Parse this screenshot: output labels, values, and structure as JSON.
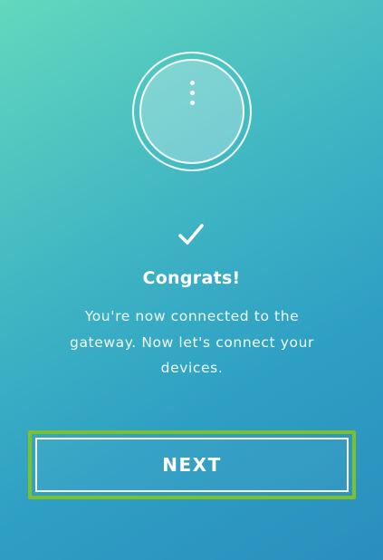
{
  "colors": {
    "background_top": "#63d8bd",
    "background_bottom": "#2b8ebd",
    "highlight": "#7cc127",
    "text": "#ffffff"
  },
  "illustration": {
    "icon": "gateway-device-icon"
  },
  "status": {
    "icon": "checkmark-icon",
    "title": "Congrats!",
    "message": "You're now connected to the gateway. Now let's connect your devices."
  },
  "actions": {
    "next_label": "NEXT"
  }
}
